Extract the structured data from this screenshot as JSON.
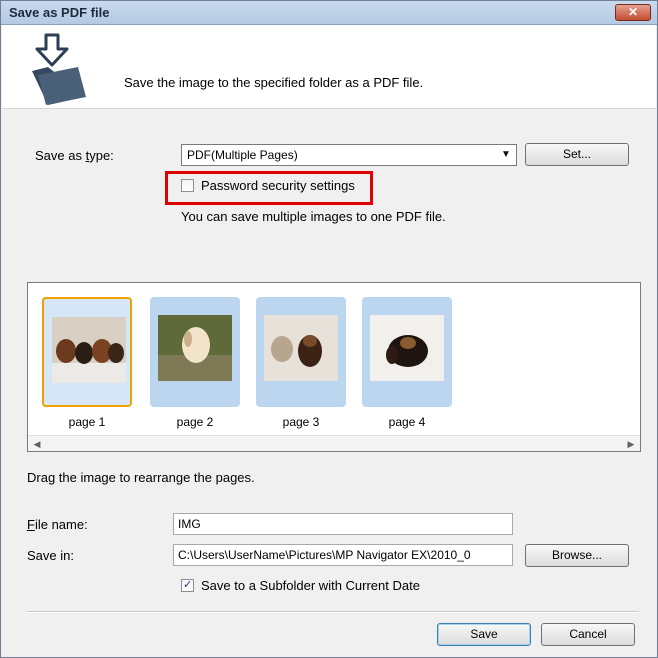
{
  "window": {
    "title": "Save as PDF file",
    "close_label": "✕"
  },
  "header": {
    "description": "Save the image to the specified folder as a PDF file.",
    "icon": "folder-save-icon"
  },
  "save_type": {
    "label": "Save as type:",
    "selected": "PDF(Multiple Pages)",
    "set_button": "Set..."
  },
  "password": {
    "label": "Password security settings",
    "checked": false
  },
  "info_text": "You can save multiple images to one PDF file.",
  "thumbnails": [
    {
      "label": "page 1",
      "selected": true,
      "icon": "dog-photo"
    },
    {
      "label": "page 2",
      "selected": false,
      "icon": "dog-photo"
    },
    {
      "label": "page 3",
      "selected": false,
      "icon": "dog-photo"
    },
    {
      "label": "page 4",
      "selected": false,
      "icon": "dog-photo"
    }
  ],
  "drag_hint": "Drag the image to rearrange the pages.",
  "file_name": {
    "label": "File name:",
    "value": "IMG"
  },
  "save_in": {
    "label": "Save in:",
    "value": "C:\\Users\\UserName\\Pictures\\MP Navigator EX\\2010_0",
    "browse_button": "Browse..."
  },
  "subfolder": {
    "label": "Save to a Subfolder with Current Date",
    "checked": true
  },
  "buttons": {
    "save": "Save",
    "cancel": "Cancel"
  },
  "colors": {
    "highlight": "#e00000",
    "selected_thumb_border": "#f0a000",
    "thumb_bg": "#bcd6ef"
  }
}
